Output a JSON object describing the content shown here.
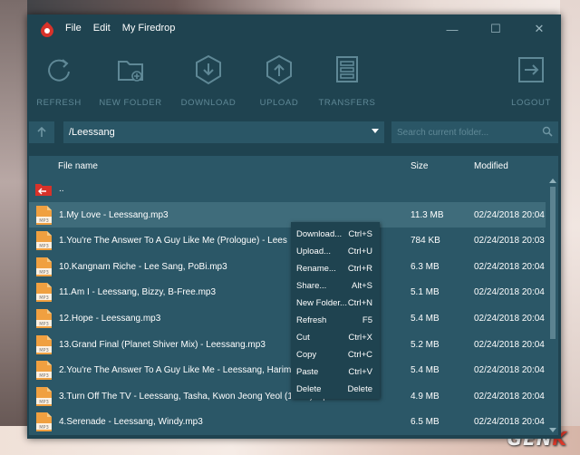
{
  "menu": {
    "file": "File",
    "edit": "Edit",
    "my_firedrop": "My Firedrop"
  },
  "window_controls": {
    "minimize": "—",
    "maximize": "☐",
    "close": "✕"
  },
  "toolbar": {
    "refresh": "REFRESH",
    "new_folder": "NEW FOLDER",
    "download": "DOWNLOAD",
    "upload": "UPLOAD",
    "transfers": "TRANSFERS",
    "logout": "LOGOUT"
  },
  "pathbar": {
    "current_path": "/Leessang",
    "search_placeholder": "Search current folder..."
  },
  "list_header": {
    "name": "File name",
    "size": "Size",
    "modified": "Modified"
  },
  "rows": [
    {
      "name": "..",
      "size": "",
      "modified": "",
      "icon": "folder-up-icon"
    },
    {
      "name": "1.My Love - Leessang.mp3",
      "size": "11.3 MB",
      "modified": "02/24/2018 20:04",
      "icon": "mp3-icon"
    },
    {
      "name": "1.You're The Answer To A Guy Like Me (Prologue) - Lees",
      "size": "784 KB",
      "modified": "02/24/2018 20:03",
      "icon": "mp3-icon"
    },
    {
      "name": "10.Kangnam Riche - Lee Sang, PoBi.mp3",
      "size": "6.3 MB",
      "modified": "02/24/2018 20:04",
      "icon": "mp3-icon"
    },
    {
      "name": "11.Am I - Leessang, Bizzy, B-Free.mp3",
      "size": "5.1 MB",
      "modified": "02/24/2018 20:04",
      "icon": "mp3-icon"
    },
    {
      "name": "12.Hope - Leessang.mp3",
      "size": "5.4 MB",
      "modified": "02/24/2018 20:04",
      "icon": "mp3-icon"
    },
    {
      "name": "13.Grand Final (Planet Shiver Mix) - Leessang.mp3",
      "size": "5.2 MB",
      "modified": "02/24/2018 20:04",
      "icon": "mp3-icon"
    },
    {
      "name": "2.You're The Answer To A Guy Like Me - Leessang, Harim.",
      "size": "5.4 MB",
      "modified": "02/24/2018 20:04",
      "icon": "mp3-icon"
    },
    {
      "name": "3.Turn Off The TV - Leessang, Tasha, Kwon Jeong Yeol (10cm).mp3",
      "size": "4.9 MB",
      "modified": "02/24/2018 20:04",
      "icon": "mp3-icon"
    },
    {
      "name": "4.Serenade - Leessang, Windy.mp3",
      "size": "6.5 MB",
      "modified": "02/24/2018 20:04",
      "icon": "mp3-icon"
    }
  ],
  "context_menu": [
    {
      "label": "Download...",
      "shortcut": "Ctrl+S"
    },
    {
      "label": "Upload...",
      "shortcut": "Ctrl+U"
    },
    {
      "label": "Rename...",
      "shortcut": "Ctrl+R"
    },
    {
      "label": "Share...",
      "shortcut": "Alt+S"
    },
    {
      "label": "New Folder...",
      "shortcut": "Ctrl+N"
    },
    {
      "label": "Refresh",
      "shortcut": "F5"
    },
    {
      "label": "Cut",
      "shortcut": "Ctrl+X"
    },
    {
      "label": "Copy",
      "shortcut": "Ctrl+C"
    },
    {
      "label": "Paste",
      "shortcut": "Ctrl+V"
    },
    {
      "label": "Delete",
      "shortcut": "Delete"
    }
  ],
  "watermark": {
    "prefix": "GEN",
    "accent": "K"
  },
  "colors": {
    "window_bg": "#1f4350",
    "list_bg": "#2b5767",
    "selected_row": "#3f6c7b",
    "toolbar_icon": "#5f8896",
    "mp3_icon": "#f0a040",
    "folder_icon": "#d8322a"
  }
}
